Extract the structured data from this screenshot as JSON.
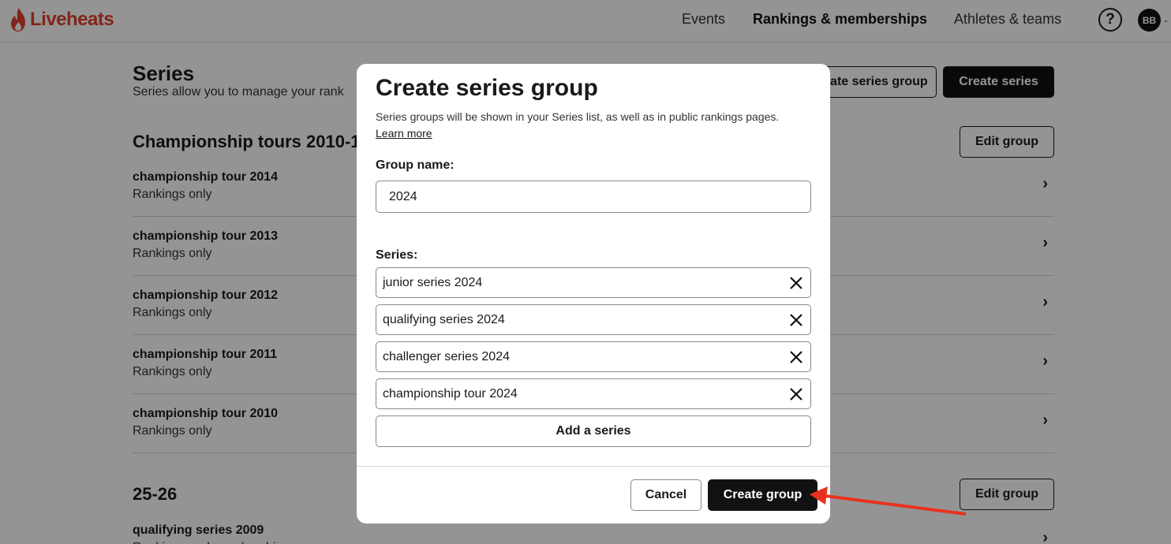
{
  "header": {
    "logo_text": "Liveheats",
    "nav": [
      {
        "label": "Events"
      },
      {
        "label": "Rankings & memberships"
      },
      {
        "label": "Athletes & teams"
      }
    ],
    "help_icon": "?",
    "avatar_initials": "BB"
  },
  "page": {
    "title": "Series",
    "subtitle": "Series allow you to manage your rank",
    "create_group_button": "Create series group",
    "create_series_button": "Create series",
    "groups": [
      {
        "title": "Championship tours 2010-1",
        "edit_label": "Edit group",
        "items": [
          {
            "name": "championship tour 2014",
            "type": "Rankings only"
          },
          {
            "name": "championship tour 2013",
            "type": "Rankings only"
          },
          {
            "name": "championship tour 2012",
            "type": "Rankings only"
          },
          {
            "name": "championship tour 2011",
            "type": "Rankings only"
          },
          {
            "name": "championship tour 2010",
            "type": "Rankings only"
          }
        ]
      },
      {
        "title": "25-26",
        "edit_label": "Edit group",
        "items": [
          {
            "name": "qualifying series 2009",
            "type": "Rankings and memberships"
          }
        ]
      }
    ]
  },
  "modal": {
    "title": "Create series group",
    "description": "Series groups will be shown in your Series list, as well as in public rankings pages.",
    "learn_more": "Learn more",
    "group_name_label": "Group name:",
    "group_name_value": "2024",
    "series_label": "Series:",
    "series": [
      {
        "name": "junior series 2024"
      },
      {
        "name": "qualifying series 2024"
      },
      {
        "name": "challenger series 2024"
      },
      {
        "name": "championship tour 2024"
      }
    ],
    "add_series": "Add a series",
    "cancel": "Cancel",
    "submit": "Create group"
  },
  "colors": {
    "brand": "#e2412b",
    "primary_button": "#111111",
    "annotation_arrow": "#e8321e"
  }
}
